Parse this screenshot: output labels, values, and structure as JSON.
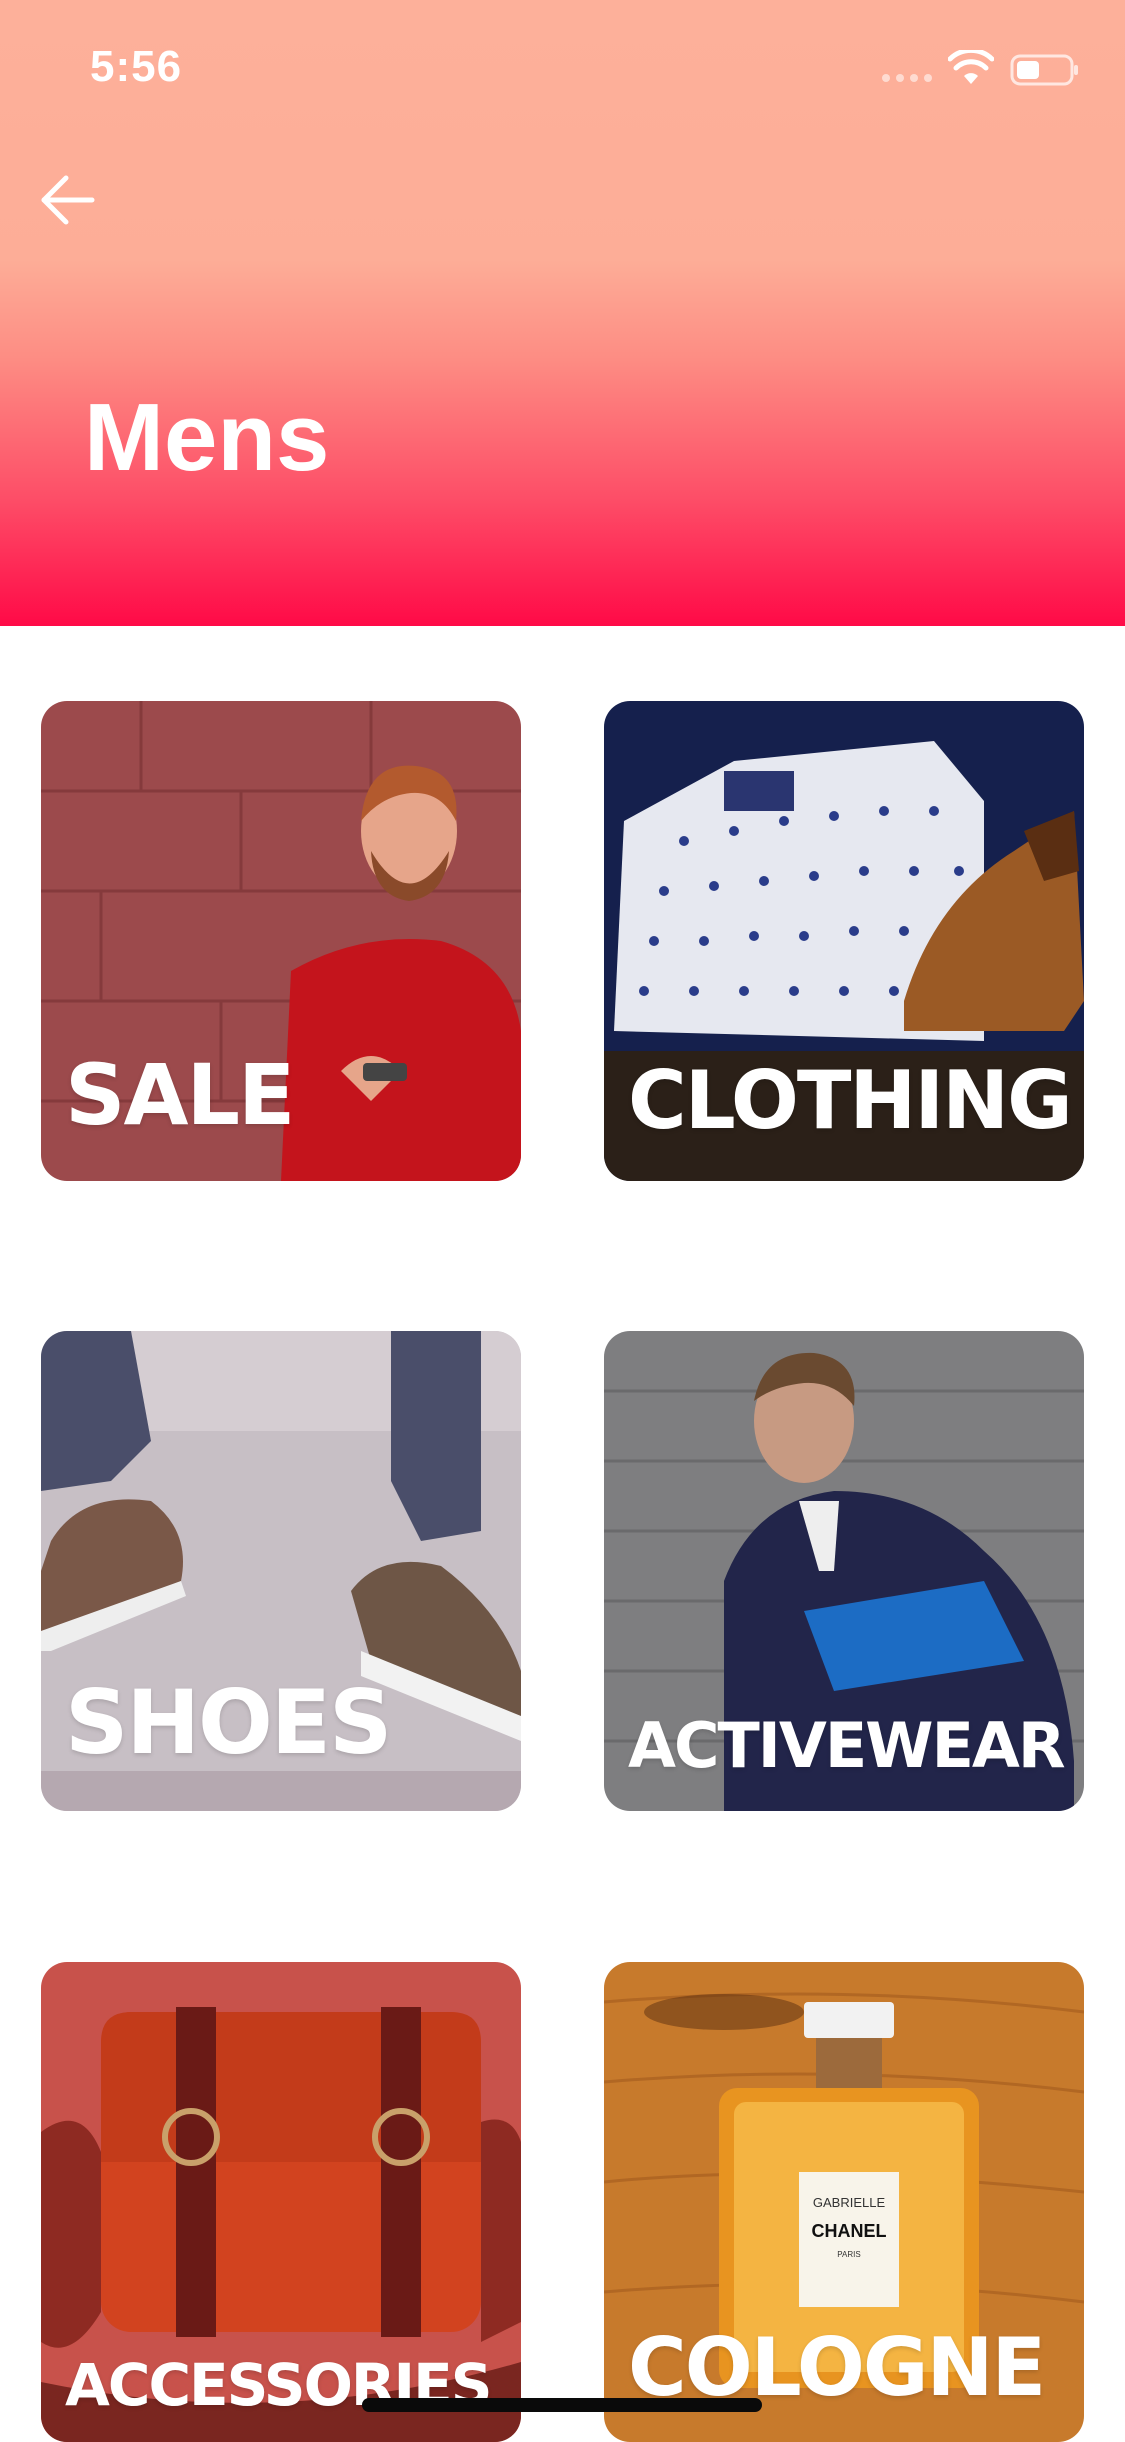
{
  "status_bar": {
    "time": "5:56"
  },
  "header": {
    "title": "Mens",
    "back_icon": "arrow-left-icon",
    "gradient_colors": [
      "#fdb09a",
      "#ff0a47"
    ]
  },
  "categories": [
    {
      "label": "SALE",
      "tint": "#a8232f",
      "icon": "sale-photo"
    },
    {
      "label": "CLOTHING",
      "tint": "#14204e",
      "icon": "clothing-photo"
    },
    {
      "label": "SHOES",
      "tint": "#b9a9b1",
      "icon": "shoes-photo"
    },
    {
      "label": "ACTIVEWEAR",
      "tint": "#6c7076",
      "icon": "activewear-photo"
    },
    {
      "label": "ACCESSORIES",
      "tint": "#c5534c",
      "icon": "accessories-photo"
    },
    {
      "label": "COLOGNE",
      "tint": "#c77a2c",
      "icon": "cologne-photo"
    }
  ],
  "cologne_bottle": {
    "line1": "GABRIELLE",
    "line2": "CHANEL",
    "line3": "PARIS"
  }
}
